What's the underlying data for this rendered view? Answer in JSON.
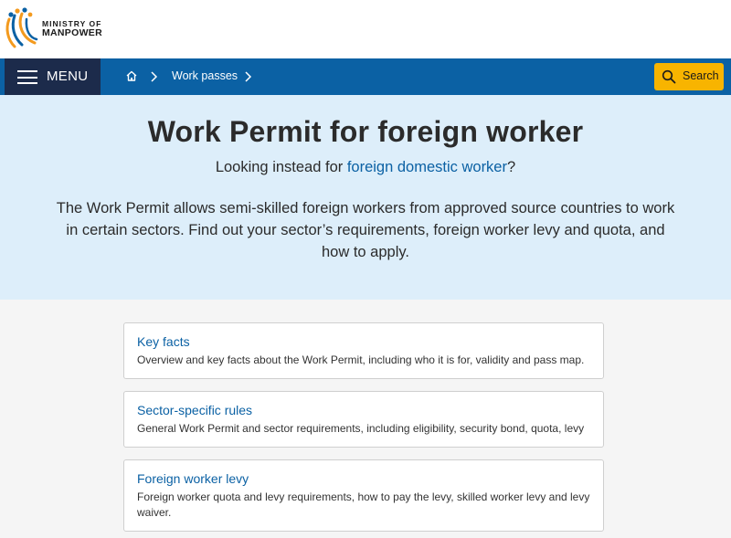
{
  "logo": {
    "line1": "MINISTRY OF",
    "line2": "MANPOWER"
  },
  "navbar": {
    "menu_label": "MENU",
    "breadcrumb": {
      "home_icon": "home-icon",
      "current": "Work passes"
    },
    "search_label": "Search"
  },
  "hero": {
    "title": "Work Permit for foreign worker",
    "alt_prefix": "Looking instead for ",
    "alt_link": "foreign domestic worker",
    "alt_suffix": "?",
    "description": "The Work Permit allows semi-skilled foreign workers from approved source countries to work in certain sectors. Find out your sector’s requirements, foreign worker levy and quota, and how to apply."
  },
  "cards": [
    {
      "title": "Key facts",
      "description": "Overview and key facts about the Work Permit, including who it is for, validity and pass map."
    },
    {
      "title": "Sector-specific rules",
      "description": "General Work Permit and sector requirements, including eligibility, security bond, quota, levy"
    },
    {
      "title": "Foreign worker levy",
      "description": "Foreign worker quota and levy requirements, how to pay the levy, skilled worker levy and levy waiver."
    }
  ],
  "colors": {
    "nav_blue": "#0b61a4",
    "menu_navy": "#1c2b4b",
    "search_yellow": "#f8b400",
    "hero_bg": "#ddeefa",
    "link_blue": "#0b61a4"
  }
}
